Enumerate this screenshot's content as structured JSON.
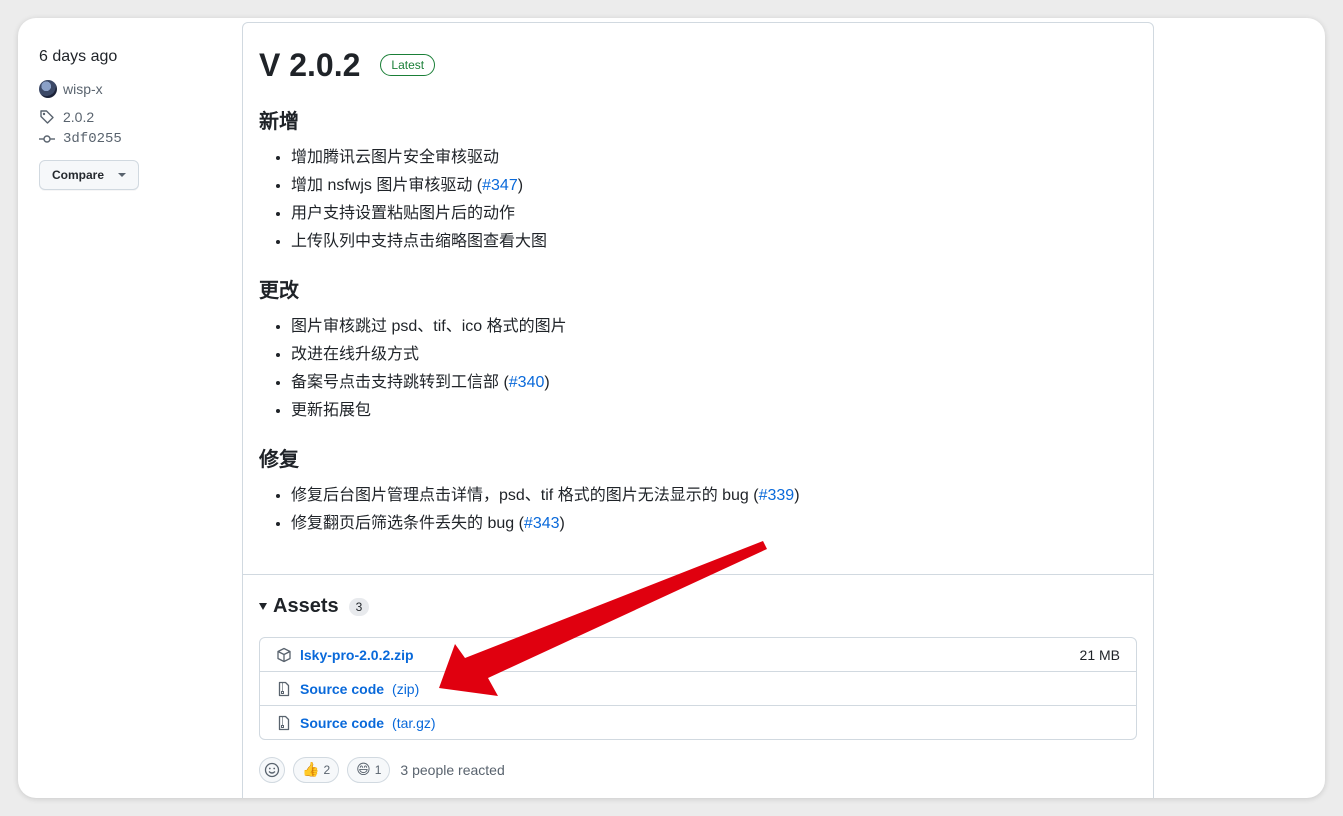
{
  "meta": {
    "date": "6 days ago",
    "author": "wisp-x",
    "tag": "2.0.2",
    "commit": "3df0255",
    "compare_label": "Compare"
  },
  "release": {
    "title": "V 2.0.2",
    "badge": "Latest",
    "sections": [
      {
        "heading": "新增",
        "items": [
          {
            "text": "增加腾讯云图片安全审核驱动",
            "link": ""
          },
          {
            "text": "增加 nsfwjs 图片审核驱动 (",
            "link": "#347",
            "after": ")"
          },
          {
            "text": "用户支持设置粘贴图片后的动作",
            "link": ""
          },
          {
            "text": "上传队列中支持点击缩略图查看大图",
            "link": ""
          }
        ]
      },
      {
        "heading": "更改",
        "items": [
          {
            "text": "图片审核跳过 psd、tif、ico 格式的图片",
            "link": ""
          },
          {
            "text": "改进在线升级方式",
            "link": ""
          },
          {
            "text": "备案号点击支持跳转到工信部 (",
            "link": "#340",
            "after": ")"
          },
          {
            "text": "更新拓展包",
            "link": ""
          }
        ]
      },
      {
        "heading": "修复",
        "items": [
          {
            "text": "修复后台图片管理点击详情，psd、tif 格式的图片无法显示的 bug (",
            "link": "#339",
            "after": ")"
          },
          {
            "text": "修复翻页后筛选条件丢失的 bug (",
            "link": "#343",
            "after": ")"
          }
        ]
      }
    ]
  },
  "assets": {
    "title": "Assets",
    "count": "3",
    "rows": [
      {
        "icon": "package-icon",
        "name": "lsky-pro-2.0.2.zip",
        "ext": "",
        "size": "21 MB"
      },
      {
        "icon": "file-zip-icon",
        "name": "Source code",
        "ext": "(zip)",
        "size": ""
      },
      {
        "icon": "file-zip-icon",
        "name": "Source code",
        "ext": "(tar.gz)",
        "size": ""
      }
    ]
  },
  "reactions": {
    "thumbs_up_emoji": "👍",
    "thumbs_up_count": "2",
    "laugh_emoji": "😄",
    "laugh_count": "1",
    "summary": "3 people reacted"
  },
  "colors": {
    "link": "#0969da",
    "badge_green": "#1a7f37",
    "annotation_arrow": "#e0000f"
  }
}
